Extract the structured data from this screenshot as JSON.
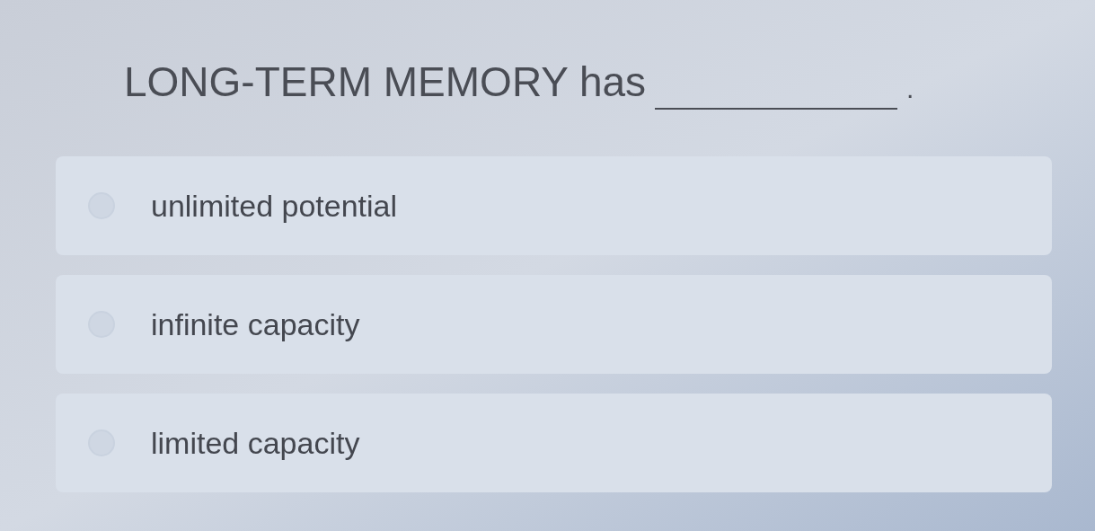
{
  "question": {
    "text": "LONG-TERM MEMORY has",
    "end": "."
  },
  "options": [
    {
      "label": "unlimited potential",
      "selected": false
    },
    {
      "label": "infinite capacity",
      "selected": false
    },
    {
      "label": "limited capacity",
      "selected": false
    }
  ]
}
